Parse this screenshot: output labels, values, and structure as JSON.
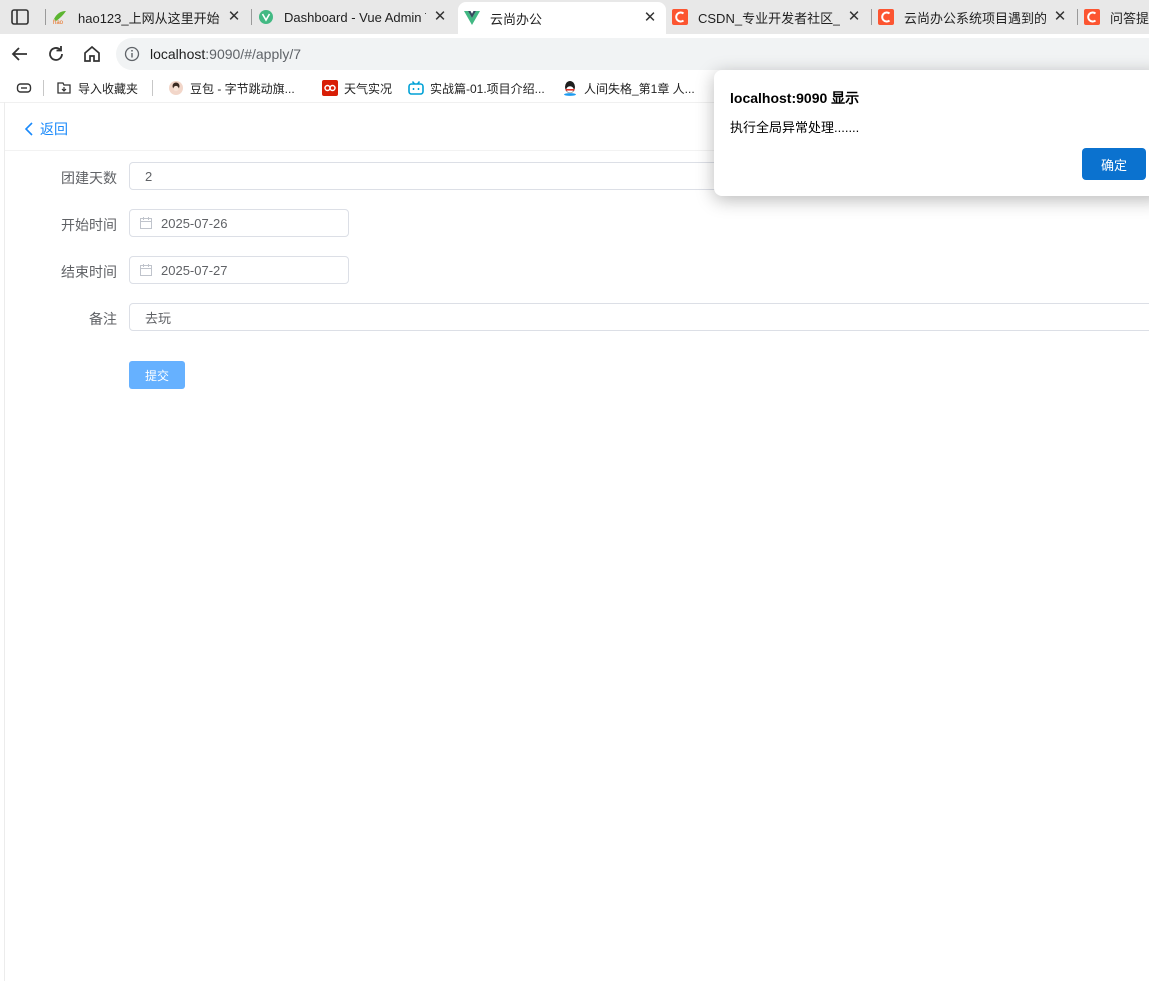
{
  "browser": {
    "tabs": [
      {
        "title": "hao123_上网从这里开始",
        "icon": "hao123-icon",
        "active": false
      },
      {
        "title": "Dashboard - Vue Admin Te",
        "icon": "vue-admin-icon",
        "active": false
      },
      {
        "title": "云尚办公",
        "icon": "vue-logo-icon",
        "active": true
      },
      {
        "title": "CSDN_专业开发者社区_已接",
        "icon": "csdn-icon",
        "active": false
      },
      {
        "title": "云尚办公系统项目遇到的问",
        "icon": "csdn-icon",
        "active": false
      },
      {
        "title": "问答提问",
        "icon": "csdn-icon",
        "active": false
      }
    ],
    "tab_close_glyph": "✕",
    "address": {
      "host": "localhost",
      "path": ":9090/#/apply/7"
    },
    "bookmarks": [
      {
        "label": "导入收藏夹",
        "icon": "import-bookmarks-icon"
      },
      {
        "label": "豆包 - 字节跳动旗...",
        "icon": "doubao-icon"
      },
      {
        "label": "天气实况",
        "icon": "weather-icon"
      },
      {
        "label": "实战篇-01.项目介绍...",
        "icon": "bilibili-icon"
      },
      {
        "label": "人间失格_第1章 人...",
        "icon": "qq-icon"
      }
    ]
  },
  "page": {
    "back_label": "返回",
    "form": {
      "days": {
        "label": "团建天数",
        "value": "2"
      },
      "start": {
        "label": "开始时间",
        "value": "2025-07-26"
      },
      "end": {
        "label": "结束时间",
        "value": "2025-07-27"
      },
      "remark": {
        "label": "备注",
        "value": "去玩"
      }
    },
    "submit_label": "提交"
  },
  "alert": {
    "title": "localhost:9090 显示",
    "message": "执行全局异常处理.......",
    "ok_label": "确定"
  },
  "colors": {
    "link": "#1989fa",
    "submit": "#66b1ff",
    "dialog_button": "#0b72cf",
    "csdn": "#fc5531"
  }
}
